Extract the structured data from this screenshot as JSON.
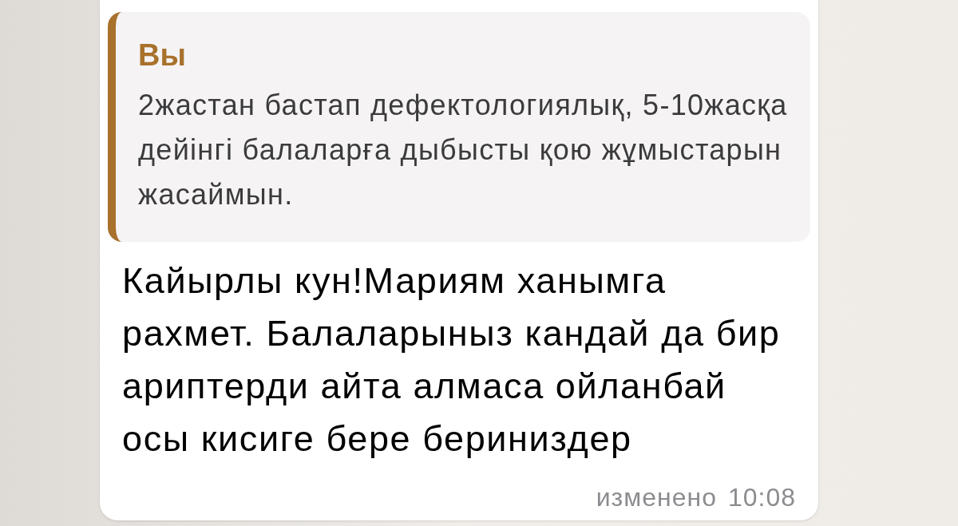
{
  "message": {
    "reply_quote": {
      "sender": "Вы",
      "text": "2жастан бастап дефектологиялық, 5-10жасқа дейінгі балаларға дыбысты қою жұмыстарын жасаймын."
    },
    "text": "Кайырлы кун!Мариям ханымга рахмет. Балаларыныз кандай да бир ариптерди айта алмаса ойланбай осы кисиге бере бериниздер",
    "edited_label": "изменено",
    "time": "10:08"
  }
}
